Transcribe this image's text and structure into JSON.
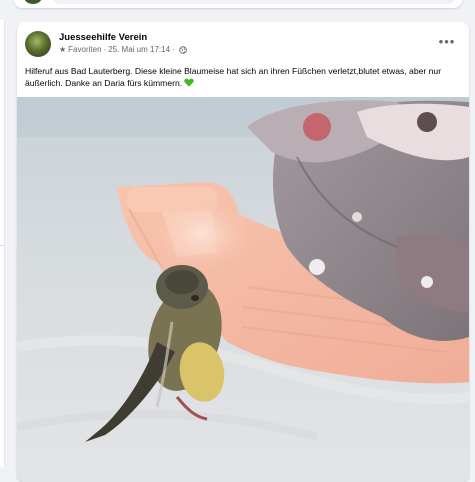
{
  "post": {
    "author": "Juesseehilfe Verein",
    "favorites_label": "Favoriten",
    "separator": "·",
    "timestamp": "25. Mai um 17:14",
    "separator2": "·",
    "text": "Hilferuf aus Bad Lauterberg. Diese kleine Blaumeise hat sich an ihren Füßchen verletzt,blutet etwas, aber nur äußerlich. Danke an Daria fürs kümmern.",
    "more_label": "•••"
  },
  "colors": {
    "author_text": "#050505",
    "meta_text": "#65676b",
    "heart": "#42b72a",
    "page_bg": "#f0f2f5"
  },
  "icons": {
    "favorites": "star-icon",
    "audience": "globe-icon",
    "reaction": "green-heart-icon",
    "options": "more-options-icon"
  }
}
